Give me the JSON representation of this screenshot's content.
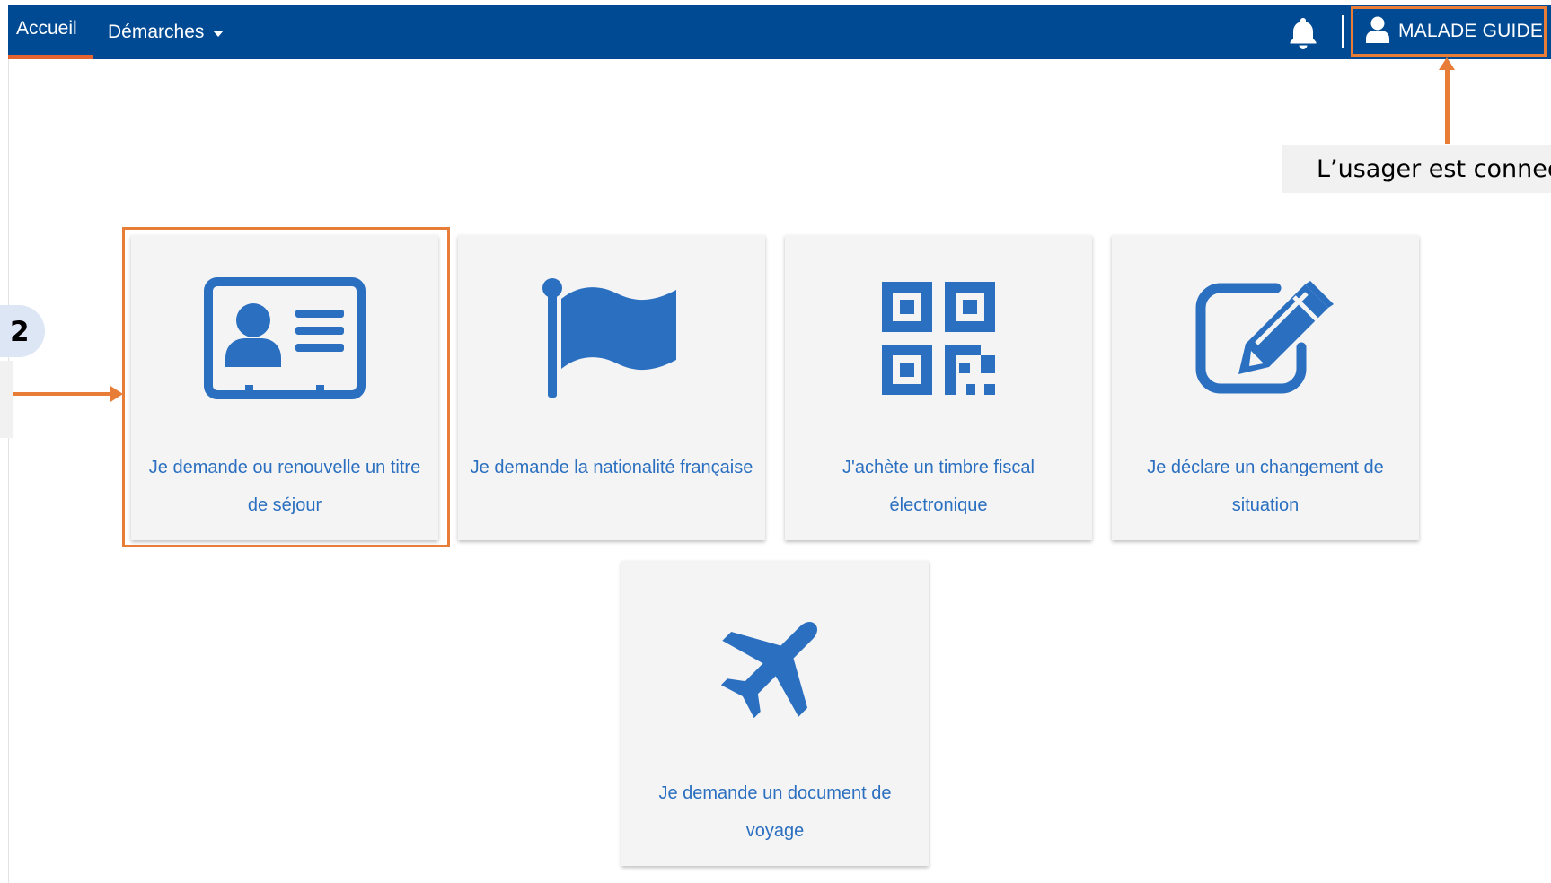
{
  "navbar": {
    "home_label": "Accueil",
    "demarches_label": "Démarches",
    "user_name": "MALADE GUIDE"
  },
  "annotations": {
    "callout_text": "L’usager est connec",
    "step_number": "2"
  },
  "cards": [
    {
      "icon": "id-card-icon",
      "label": "Je demande ou renouvelle un titre de séjour"
    },
    {
      "icon": "flag-icon",
      "label": "Je demande la nationalité française"
    },
    {
      "icon": "qr-code-icon",
      "label": "J'achète un timbre fiscal électronique"
    },
    {
      "icon": "edit-icon",
      "label": "Je déclare un changement de situation"
    },
    {
      "icon": "airplane-icon",
      "label": "Je demande un document de voyage"
    }
  ],
  "colors": {
    "navbar": "#004a93",
    "accent": "#e6642f",
    "annotation": "#e87d37",
    "icon_blue": "#2a6fc0",
    "card_bg": "#f4f4f4"
  }
}
